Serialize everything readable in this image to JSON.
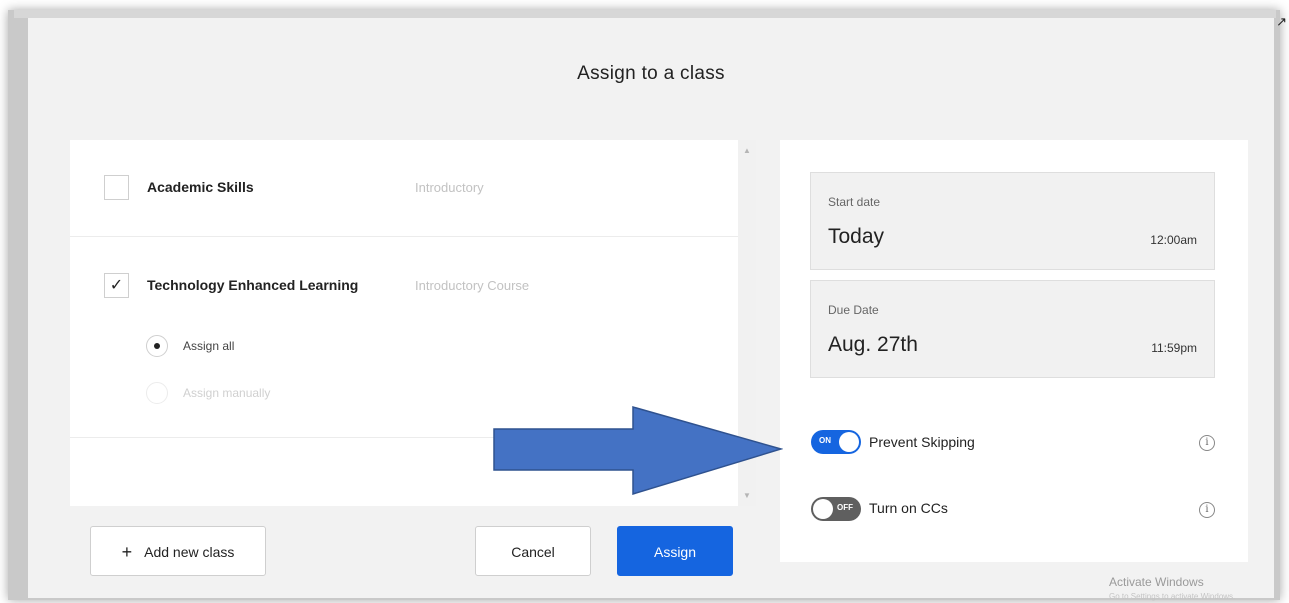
{
  "dialog": {
    "title": "Assign to a class"
  },
  "classes": [
    {
      "name": "Academic Skills",
      "level": "Introductory",
      "checked": false,
      "check_mark": ""
    },
    {
      "name": "Technology Enhanced Learning",
      "level": "Introductory Course",
      "checked": true,
      "check_mark": "✓"
    }
  ],
  "assign_options": [
    {
      "label": "Assign all",
      "selected": true
    },
    {
      "label": "Assign manually",
      "selected": false
    }
  ],
  "buttons": {
    "add_class": "Add new class",
    "cancel": "Cancel",
    "assign": "Assign"
  },
  "dates": {
    "start": {
      "label": "Start date",
      "value": "Today",
      "time": "12:00am"
    },
    "due": {
      "label": "Due Date",
      "value": "Aug. 27th",
      "time": "11:59pm"
    }
  },
  "settings": [
    {
      "label": "Prevent Skipping",
      "state": "ON",
      "on": true
    },
    {
      "label": "Turn on CCs",
      "state": "OFF",
      "on": false
    }
  ],
  "annotation": {
    "arrow_color": "#4472c4",
    "arrow_points_to": "prevent-skipping-toggle"
  },
  "watermark": {
    "title": "Activate Windows",
    "subtitle": "Go to Settings to activate Windows."
  },
  "colors": {
    "accent": "#1565e0",
    "toggle_off": "#5f5f5f"
  }
}
